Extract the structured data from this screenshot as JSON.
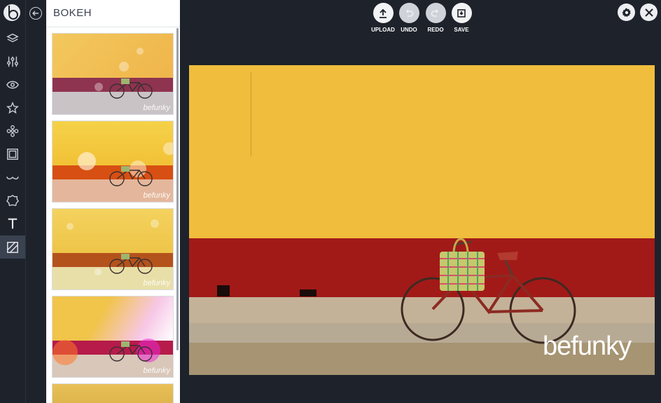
{
  "panel": {
    "title": "BOKEH"
  },
  "toolbar": {
    "upload_label": "UPLOAD",
    "undo_label": "UNDO",
    "redo_label": "REDO",
    "save_label": "SAVE"
  },
  "rail_icons": [
    "layers-icon",
    "sliders-icon",
    "eye-icon",
    "star-icon",
    "flower-icon",
    "frame-icon",
    "mustache-icon",
    "badge-icon",
    "text-icon",
    "texture-icon"
  ],
  "thumb_watermark": "befunky",
  "canvas": {
    "watermark": "befunky"
  },
  "colors": {
    "bg": "#1d222b",
    "active_rail": "#3a4250",
    "wall": "#f0bd3c",
    "band": "#a11a18"
  }
}
